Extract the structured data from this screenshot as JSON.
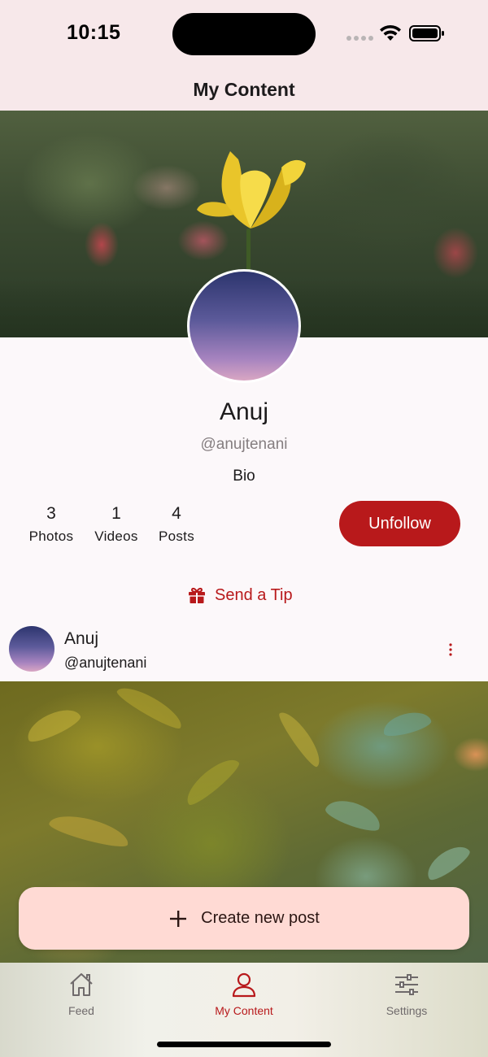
{
  "status_bar": {
    "time": "10:15"
  },
  "app_bar": {
    "title": "My Content"
  },
  "profile": {
    "name": "Anuj",
    "handle": "@anujtenani",
    "bio": "Bio",
    "stats": [
      {
        "value": "3",
        "label": "Photos"
      },
      {
        "value": "1",
        "label": "Videos"
      },
      {
        "value": "4",
        "label": "Posts"
      }
    ],
    "unfollow_label": "Unfollow",
    "tip_label": "Send a Tip"
  },
  "post": {
    "author": "Anuj",
    "handle": "@anujtenani"
  },
  "create_post_label": "Create new post",
  "bottom_nav": {
    "items": [
      {
        "label": "Feed",
        "icon": "home-icon"
      },
      {
        "label": "My Content",
        "icon": "person-icon",
        "active": true
      },
      {
        "label": "Settings",
        "icon": "sliders-icon"
      }
    ]
  },
  "colors": {
    "accent": "#b8191b",
    "header_bg": "#f7e8ea",
    "create_button_bg": "#ffdad4"
  }
}
